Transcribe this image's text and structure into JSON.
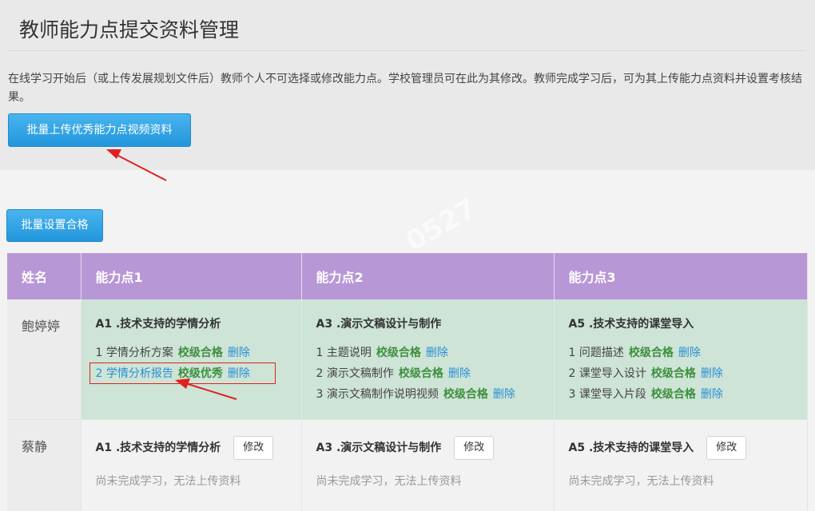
{
  "header": {
    "title": "教师能力点提交资料管理",
    "description": "在线学习开始后（或上传发展规划文件后）教师个人不可选择或修改能力点。学校管理员可在此为其修改。教师完成学习后，可为其上传能力点资料并设置考核结果。",
    "upload_button": "批量上传优秀能力点视频资料"
  },
  "batch_button": "批量设置合格",
  "table": {
    "headers": [
      "姓名",
      "能力点1",
      "能力点2",
      "能力点3"
    ],
    "rows": [
      {
        "name": "鲍婷婷",
        "points": [
          {
            "title": "A1 .技术支持的学情分析",
            "items": [
              {
                "text": "1 学情分析方案",
                "level": "校级合格",
                "action": "删除"
              },
              {
                "text": "2 学情分析报告",
                "level": "校级优秀",
                "action": "删除"
              }
            ]
          },
          {
            "title": "A3 .演示文稿设计与制作",
            "items": [
              {
                "text": "1 主题说明",
                "level": "校级合格",
                "action": "删除"
              },
              {
                "text": "2 演示文稿制作",
                "level": "校级合格",
                "action": "删除"
              },
              {
                "text": "3 演示文稿制作说明视频",
                "level": "校级合格",
                "action": "删除"
              }
            ]
          },
          {
            "title": "A5 .技术支持的课堂导入",
            "items": [
              {
                "text": "1 问题描述",
                "level": "校级合格",
                "action": "删除"
              },
              {
                "text": "2 课堂导入设计",
                "level": "校级合格",
                "action": "删除"
              },
              {
                "text": "3 课堂导入片段",
                "level": "校级合格",
                "action": "删除"
              }
            ]
          }
        ]
      },
      {
        "name": "蔡静",
        "points": [
          {
            "title": "A1 .技术支持的学情分析",
            "edit": "修改",
            "status": "尚未完成学习，无法上传资料"
          },
          {
            "title": "A3 .演示文稿设计与制作",
            "edit": "修改",
            "status": "尚未完成学习，无法上传资料"
          },
          {
            "title": "A5 .技术支持的课堂导入",
            "edit": "修改",
            "status": "尚未完成学习，无法上传资料"
          }
        ]
      }
    ]
  },
  "watermark": {
    "text1": "0527",
    "text2": "0527"
  },
  "colors": {
    "accent": "#2296dc",
    "header": "#b897d6",
    "pass": "#3e8f3e",
    "link": "#2a8fd6",
    "annotation": "#e02020"
  }
}
